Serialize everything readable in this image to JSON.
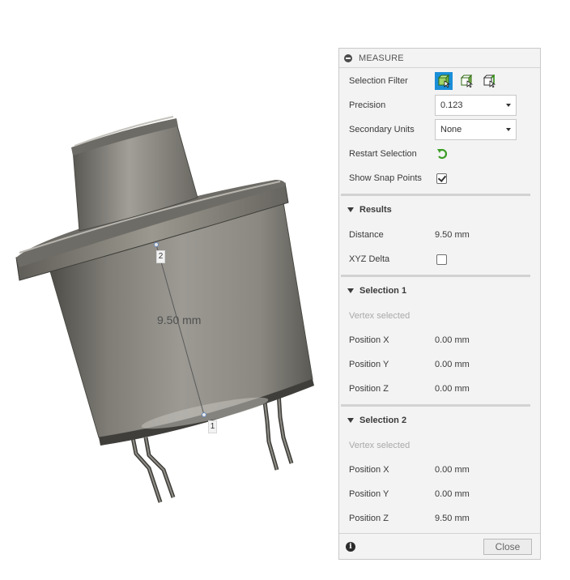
{
  "viewport": {
    "dimension_label": "9.50 mm",
    "point1_label": "1",
    "point2_label": "2"
  },
  "panel": {
    "title": "MEASURE",
    "selection_filter_label": "Selection Filter",
    "selection_filter_icons": [
      "select-body-icon",
      "select-face-icon",
      "select-edge-icon"
    ],
    "precision_label": "Precision",
    "precision_value": "0.123",
    "secondary_units_label": "Secondary Units",
    "secondary_units_value": "None",
    "restart_selection_label": "Restart Selection",
    "show_snap_points_label": "Show Snap Points",
    "show_snap_points_checked": true
  },
  "results": {
    "heading": "Results",
    "distance_label": "Distance",
    "distance_value": "9.50 mm",
    "xyz_delta_label": "XYZ Delta",
    "xyz_delta_checked": false
  },
  "selection1": {
    "heading": "Selection 1",
    "status": "Vertex selected",
    "pos_x_label": "Position X",
    "pos_x_value": "0.00 mm",
    "pos_y_label": "Position Y",
    "pos_y_value": "0.00 mm",
    "pos_z_label": "Position Z",
    "pos_z_value": "0.00 mm"
  },
  "selection2": {
    "heading": "Selection 2",
    "status": "Vertex selected",
    "pos_x_label": "Position X",
    "pos_x_value": "0.00 mm",
    "pos_y_label": "Position Y",
    "pos_y_value": "0.00 mm",
    "pos_z_label": "Position Z",
    "pos_z_value": "9.50 mm"
  },
  "footer": {
    "info_glyph": "i",
    "close_label": "Close"
  },
  "colors": {
    "accent": "#1b8ed8",
    "restart_green": "#3a9d23",
    "body_gray": "#8a8880"
  }
}
